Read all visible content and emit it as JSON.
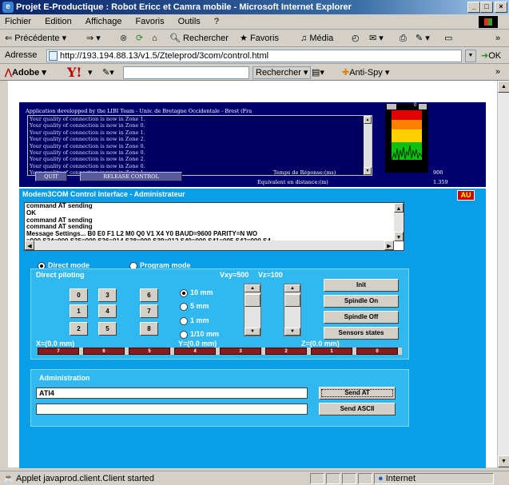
{
  "window": {
    "title": "Projet E-Productique : Robot Ericc et Camra mobile - Microsoft Internet Explorer"
  },
  "menu": [
    "Fichier",
    "Edition",
    "Affichage",
    "Favoris",
    "Outils",
    "?"
  ],
  "toolbar": {
    "back": "Précédente",
    "search": "Rechercher",
    "favorites": "Favoris",
    "media": "Média"
  },
  "address": {
    "label": "Adresse",
    "url": "http://193.194.88.13/v1.5/Zteleprod/3com/control.html",
    "go": "OK"
  },
  "searchbar": {
    "brand": "Adobe",
    "search_btn": "Rechercher",
    "antispy": "Anti-Spy"
  },
  "applet1": {
    "header": "Application developped by the LIBI Team - Univ. de Bretagne Occidentale - Brest (Fra",
    "log": [
      "Your quality of connection is now in Zone 1.",
      "Your quality of connection is now in Zone 0.",
      "Your quality of connection is now in Zone 1.",
      "Your quality of connection is now in Zone 2.",
      "Your quality of connection is now in Zone 0.",
      "Your quality of connection is now in Zone 0.",
      "Your quality of connection is now in Zone 2.",
      "Your quality of connection is now in Zone 0.",
      "Your quality of connection is now in Zone 1.",
      "Your quality of connection is now in Zone 0."
    ],
    "quit": "QUIT",
    "release": "RELEASE CONTROL",
    "response_label": "Temps de Réponse:(ms)",
    "response_value": "906",
    "distance_label": "Equivalent en distance:(m)",
    "distance_value": "1.359",
    "gauge_zero": "0"
  },
  "applet2": {
    "title": "Modem3COM Control Interface - Administrateur",
    "au": "AU",
    "log": [
      "command AT sending",
      "OK",
      "command AT sending",
      "command AT sending",
      " Message Settings...  B0  E0  F1  L2  M0  Q0  V1  X4  Y0   BAUD=9600  PARITY=N  WO",
      "=000  S34=000  S35=000  S36=014  S38=000  S39=012  S40=000  S41=005  S42=000  S4"
    ],
    "direct_mode": "Direct mode",
    "program_mode": "Program mode",
    "direct_piloting": "Direct piloting",
    "vxy": "Vxy=500",
    "vz": "Vz=100",
    "keys": [
      "0",
      "3",
      "6",
      "1",
      "4",
      "7",
      "2",
      "5",
      "8"
    ],
    "steps": [
      "10 mm",
      "5 mm",
      "1 mm",
      "1/10 mm"
    ],
    "buttons": {
      "init": "Init",
      "spindle_on": "Spindle On",
      "spindle_off": "Spindle Off",
      "sensors": "Sensors states"
    },
    "x_pos": "X=(0.0 mm)",
    "y_pos": "Y=(0.0 mm)",
    "z_pos": "Z=(0.0 mm)",
    "axis_buttons": [
      "7",
      "6",
      "5",
      "4",
      "3",
      "2",
      "1",
      "0"
    ],
    "admin_title": "Administration",
    "admin_input": "ATI4",
    "admin_input2": "",
    "send_at": "Send AT",
    "send_ascii": "Send ASCII"
  },
  "status": {
    "text": "Applet javaprod.client.Client started",
    "zone": "Internet"
  }
}
